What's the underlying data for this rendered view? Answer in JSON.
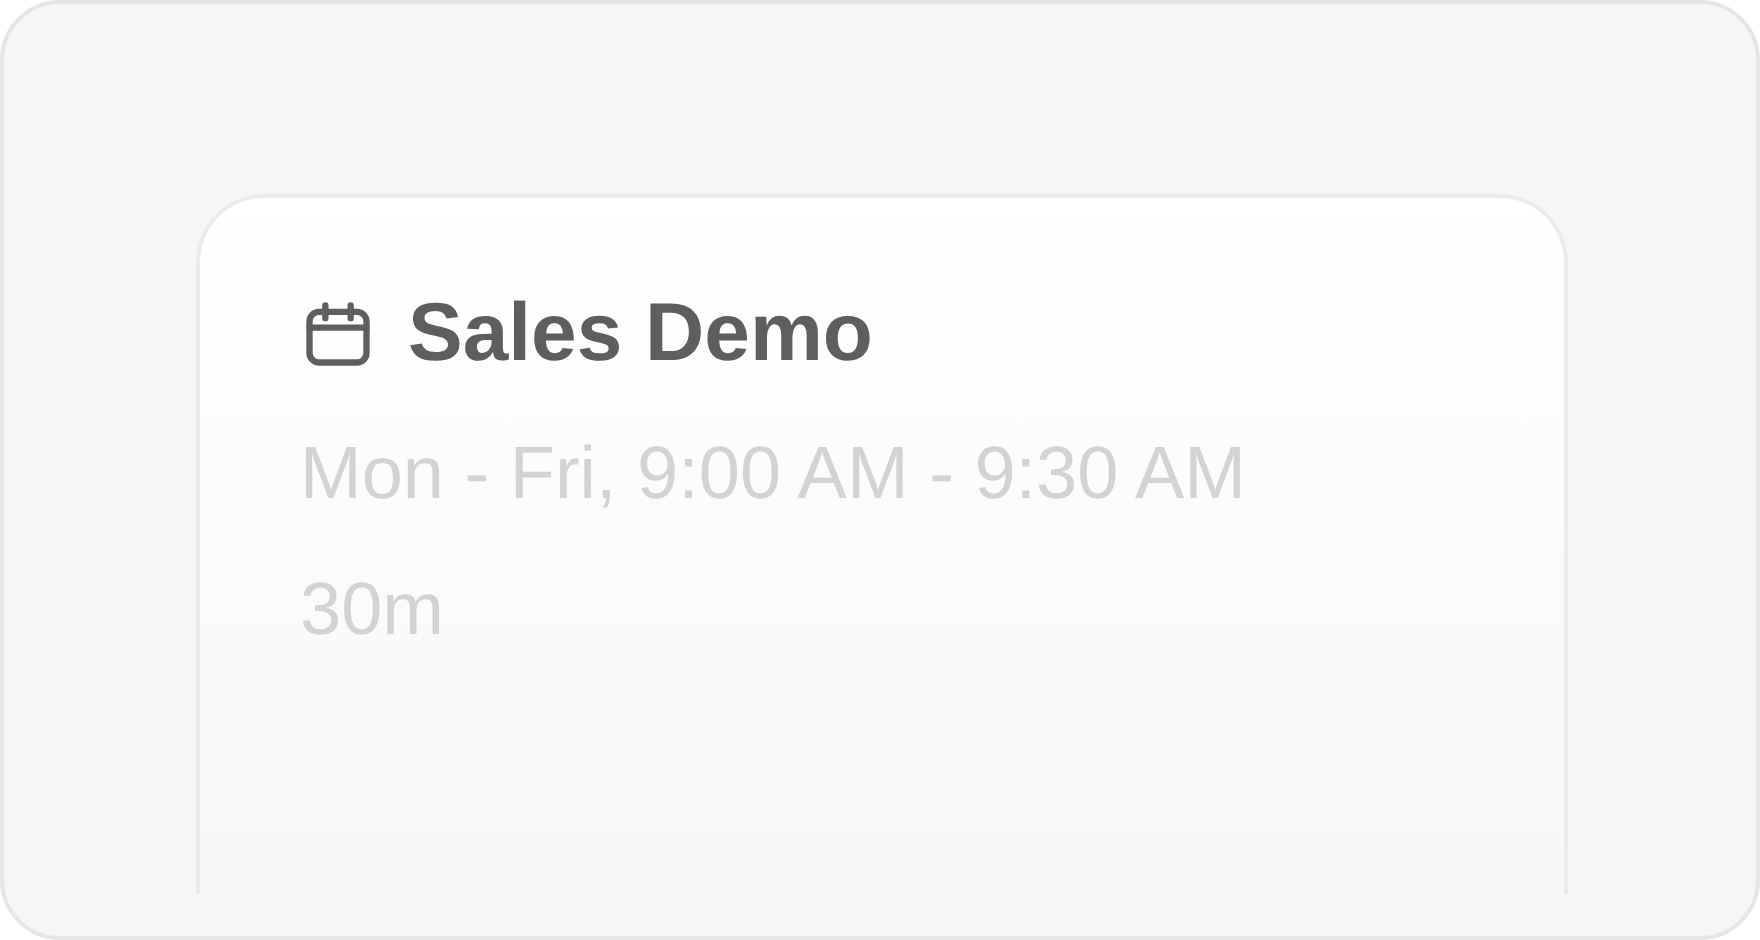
{
  "event": {
    "title": "Sales Demo",
    "schedule": "Mon - Fri, 9:00 AM - 9:30 AM",
    "duration": "30m"
  }
}
